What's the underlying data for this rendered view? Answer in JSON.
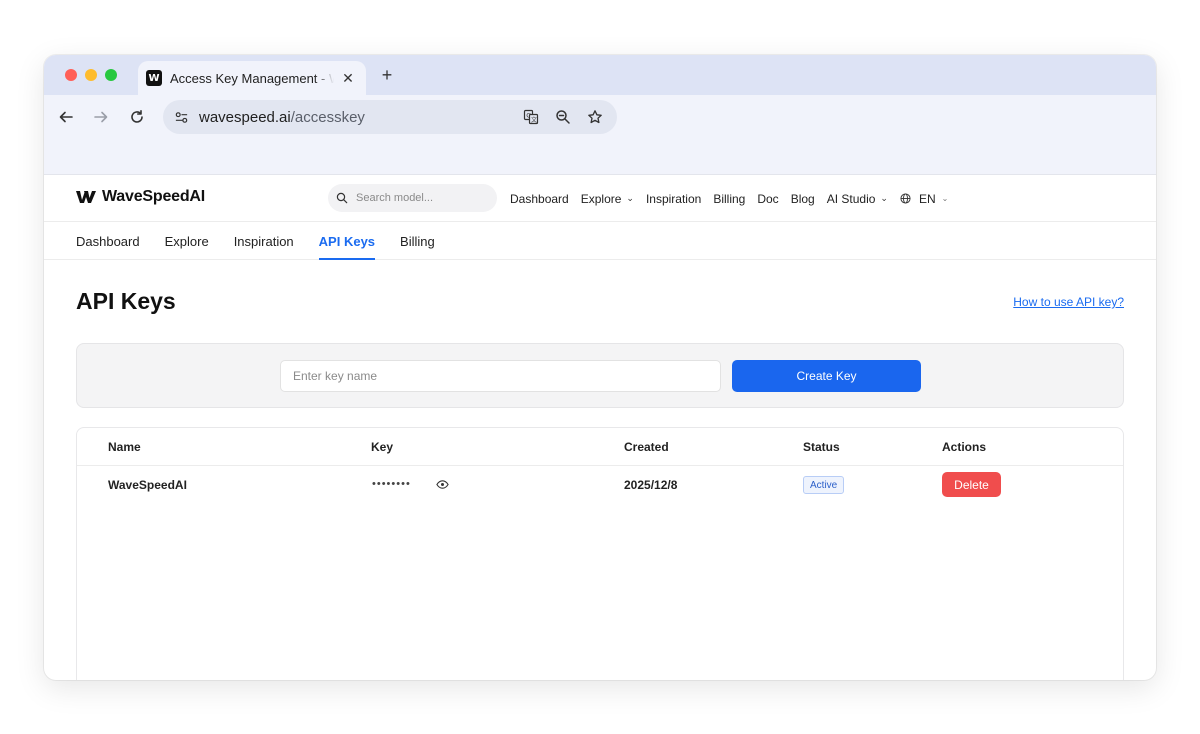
{
  "browser": {
    "tab_title": "Access Key Management - WaveSpeedAI",
    "favicon_letter": "W",
    "url_domain": "wavespeed.ai",
    "url_path": "/accesskey"
  },
  "header": {
    "logo_text": "WaveSpeedAI",
    "search_placeholder": "Search model...",
    "nav": {
      "dashboard": "Dashboard",
      "explore": "Explore",
      "inspiration": "Inspiration",
      "billing": "Billing",
      "doc": "Doc",
      "blog": "Blog",
      "ai_studio": "AI Studio"
    },
    "language": "EN"
  },
  "subnav": {
    "dashboard": "Dashboard",
    "explore": "Explore",
    "inspiration": "Inspiration",
    "api_keys": "API Keys",
    "billing": "Billing"
  },
  "main": {
    "title": "API Keys",
    "help_link": "How to use API key?",
    "key_input_placeholder": "Enter key name",
    "create_button": "Create Key"
  },
  "table": {
    "columns": {
      "name": "Name",
      "key": "Key",
      "created": "Created",
      "status": "Status",
      "actions": "Actions"
    },
    "rows": [
      {
        "name": "WaveSpeedAI",
        "key_masked": "••••••••",
        "created": "2025/12/8",
        "status": "Active",
        "action": "Delete"
      }
    ]
  },
  "colors": {
    "accent": "#1a66ee",
    "danger": "#f04d4d",
    "tab_strip": "#dde3f5"
  }
}
